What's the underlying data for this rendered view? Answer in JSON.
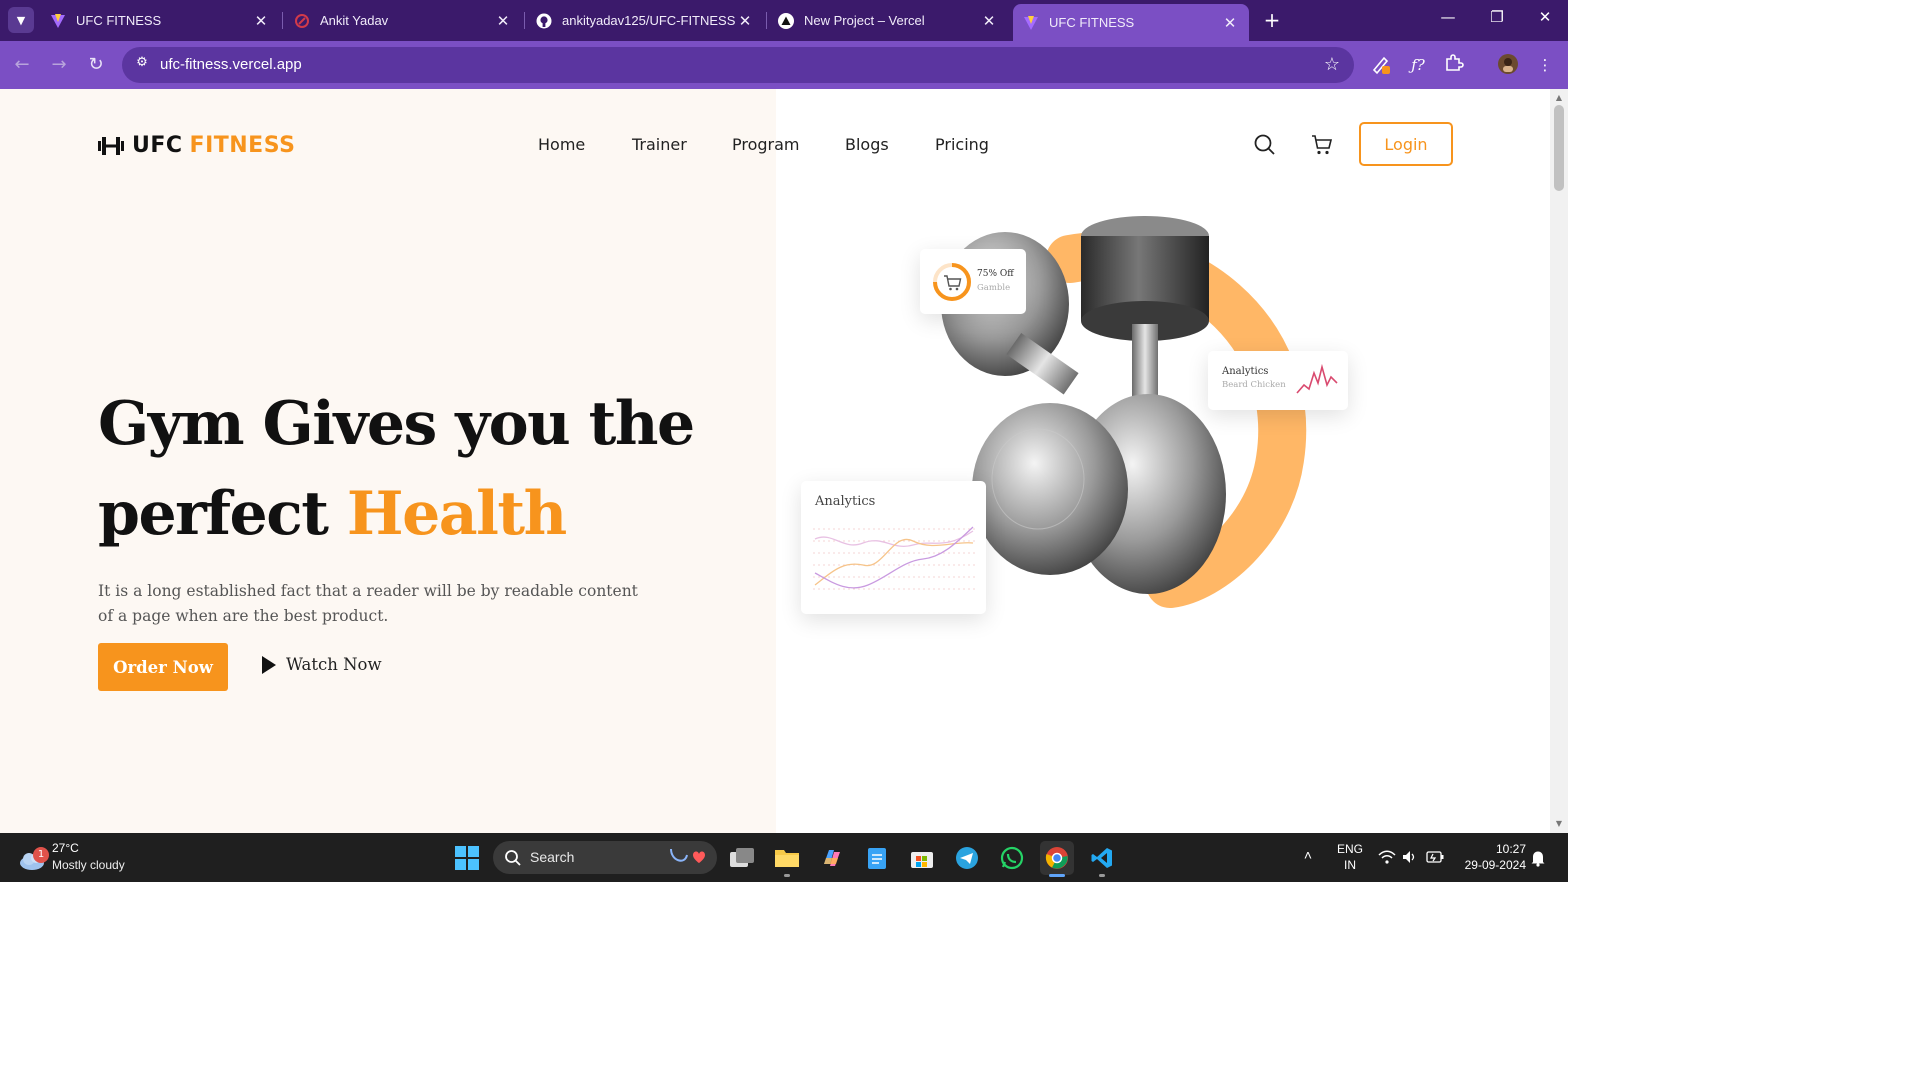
{
  "browser": {
    "tabs": [
      {
        "title": "UFC FITNESS",
        "active": false
      },
      {
        "title": "Ankit Yadav",
        "active": false
      },
      {
        "title": "ankityadav125/UFC-FITNESS",
        "active": false
      },
      {
        "title": "New Project – Vercel",
        "active": false
      },
      {
        "title": "UFC FITNESS",
        "active": true
      }
    ],
    "url": "ufc-fitness.vercel.app",
    "accent_color": "#7b4fc4"
  },
  "site": {
    "logo": {
      "part1": "UFC",
      "part2": "FITNESS"
    },
    "nav": [
      "Home",
      "Trainer",
      "Program",
      "Blogs",
      "Pricing"
    ],
    "login_label": "Login",
    "brand_color": "#f7941d"
  },
  "hero": {
    "headline_line1": "Gym Gives you the",
    "headline_line2_prefix": "perfect",
    "headline_highlight": "Health",
    "subtext": "It is a long established fact that a reader will be by readable content of a page when are the best product.",
    "order_button": "Order Now",
    "watch_button": "Watch Now"
  },
  "cards": {
    "discount": {
      "title": "75% Off",
      "subtitle": "Gamble"
    },
    "analytics_small": {
      "title": "Analytics",
      "subtitle": "Beard Chicken"
    },
    "analytics_chart": {
      "title": "Analytics"
    }
  },
  "taskbar": {
    "weather": {
      "temp": "27°C",
      "condition": "Mostly cloudy",
      "badge": "1"
    },
    "search_label": "Search",
    "lang": "ENG",
    "region": "IN",
    "time": "10:27",
    "date": "29-09-2024"
  }
}
